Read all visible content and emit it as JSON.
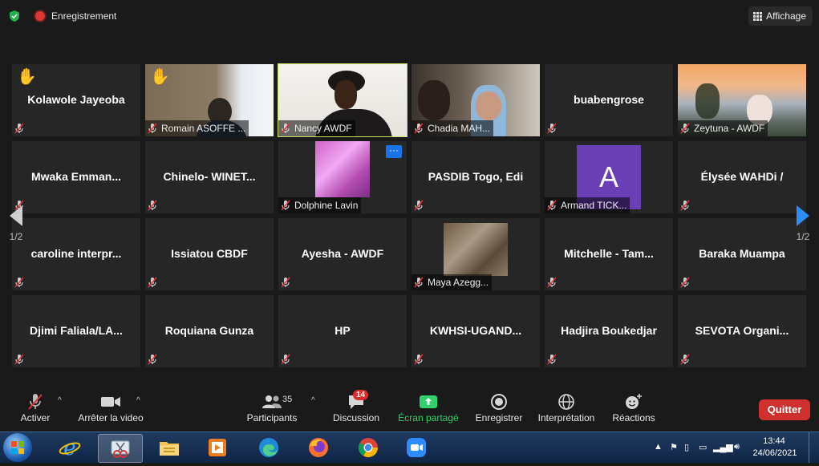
{
  "topbar": {
    "recording_label": "Enregistrement",
    "view_label": "Affichage"
  },
  "tiles": [
    {
      "name": "Kolawole Jayeoba",
      "style": "name",
      "hand": true
    },
    {
      "name": "Romain ASOFFE ...",
      "style": "video",
      "video": "romain",
      "hand": true
    },
    {
      "name": "Nancy AWDF",
      "style": "video",
      "video": "nancy",
      "active": true
    },
    {
      "name": "Chadia MAH...",
      "style": "video",
      "video": "chadia"
    },
    {
      "name": "buabengrose",
      "style": "name"
    },
    {
      "name": "Zeytuna - AWDF",
      "style": "video",
      "video": "zeytuna"
    },
    {
      "name": "Mwaka  Emman...",
      "style": "name"
    },
    {
      "name": "Chinelo-  WINET...",
      "style": "name"
    },
    {
      "name": "Dolphine Lavin",
      "style": "video",
      "video": "dolphine",
      "more": true
    },
    {
      "name": "PASDIB Togo,  Edi",
      "style": "name"
    },
    {
      "name": "Armand TICK...",
      "style": "avatar",
      "avatar_letter": "A"
    },
    {
      "name": "Élysée WAHDi /",
      "style": "name"
    },
    {
      "name": "caroline  interpr...",
      "style": "name"
    },
    {
      "name": "Issiatou  CBDF",
      "style": "name"
    },
    {
      "name": "Ayesha - AWDF",
      "style": "name"
    },
    {
      "name": "Maya Azegg...",
      "style": "video",
      "video": "maya"
    },
    {
      "name": "Mitchelle  -  Tam...",
      "style": "name"
    },
    {
      "name": "Baraka Muampa",
      "style": "name"
    },
    {
      "name": "Djimi  Faliala/LA...",
      "style": "name"
    },
    {
      "name": "Roquiana Gunza",
      "style": "name"
    },
    {
      "name": "HP",
      "style": "name"
    },
    {
      "name": "KWHSI-UGAND...",
      "style": "name"
    },
    {
      "name": "Hadjira Boukedjar",
      "style": "name"
    },
    {
      "name": "SEVOTA  Organi...",
      "style": "name"
    }
  ],
  "pagination": {
    "left": "1/2",
    "right": "1/2"
  },
  "more_glyph": "···",
  "controls": {
    "mute": "Activer",
    "video": "Arrêter la video",
    "participants": "Participants",
    "participants_count": "35",
    "chat": "Discussion",
    "chat_badge": "14",
    "share": "Écran partagé",
    "record": "Enregistrer",
    "interpretation": "Interprétation",
    "reactions": "Réactions",
    "quit": "Quitter"
  },
  "taskbar": {
    "time": "13:44",
    "date": "24/06/2021",
    "apps": [
      "internet-explorer",
      "snipping-tool",
      "file-explorer",
      "media-player",
      "edge",
      "firefox",
      "chrome",
      "zoom"
    ]
  },
  "colors": {
    "active_speaker": "#c9e05a",
    "share_green": "#2fd16b",
    "quit_red": "#d0302e",
    "nav_blue": "#2d8cff",
    "avatar_purple": "#6a3fb5"
  }
}
